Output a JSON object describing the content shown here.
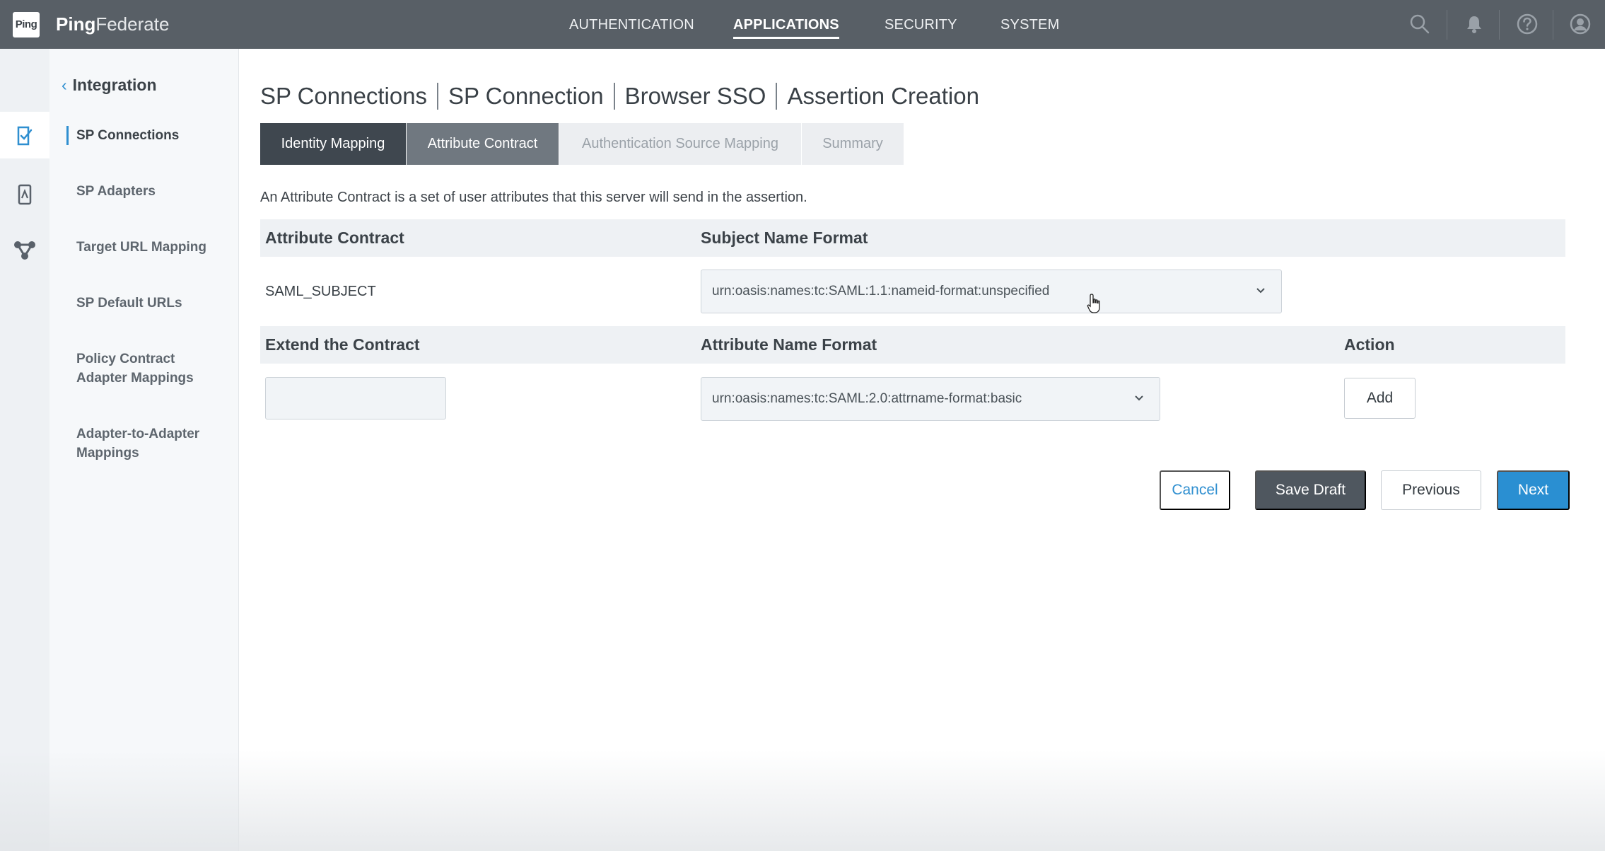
{
  "header": {
    "logo_text": "Ping",
    "brand_bold": "Ping",
    "brand_rest": "Federate",
    "nav": [
      "AUTHENTICATION",
      "APPLICATIONS",
      "SECURITY",
      "SYSTEM"
    ],
    "active_nav": "APPLICATIONS"
  },
  "sidebar": {
    "back_label": "Integration",
    "items": [
      {
        "label": "SP Connections",
        "active": true
      },
      {
        "label": "SP Adapters"
      },
      {
        "label": "Target URL Mapping"
      },
      {
        "label": "SP Default URLs"
      },
      {
        "label": "Policy Contract Adapter Mappings"
      },
      {
        "label": "Adapter-to-Adapter Mappings"
      }
    ]
  },
  "breadcrumb": [
    "SP Connections",
    "SP Connection",
    "Browser SSO",
    "Assertion Creation"
  ],
  "tabs": [
    {
      "label": "Identity Mapping",
      "state": "completed"
    },
    {
      "label": "Attribute Contract",
      "state": "current"
    },
    {
      "label": "Authentication Source Mapping",
      "state": "pending"
    },
    {
      "label": "Summary",
      "state": "pending"
    }
  ],
  "description": "An Attribute Contract is a set of user attributes that this server will send in the assertion.",
  "contract_table": {
    "headers": [
      "Attribute Contract",
      "Subject Name Format"
    ],
    "row": {
      "attribute": "SAML_SUBJECT",
      "subject_format": "urn:oasis:names:tc:SAML:1.1:nameid-format:unspecified"
    }
  },
  "extend_table": {
    "headers": [
      "Extend the Contract",
      "Attribute Name Format",
      "Action"
    ],
    "input_value": "",
    "name_format": "urn:oasis:names:tc:SAML:2.0:attrname-format:basic",
    "add_label": "Add"
  },
  "footer": {
    "cancel": "Cancel",
    "save_draft": "Save Draft",
    "previous": "Previous",
    "next": "Next"
  },
  "colors": {
    "topbar": "#585f66",
    "accent": "#2a8fd2",
    "tab_done": "#3f474f",
    "tab_current": "#707880"
  }
}
